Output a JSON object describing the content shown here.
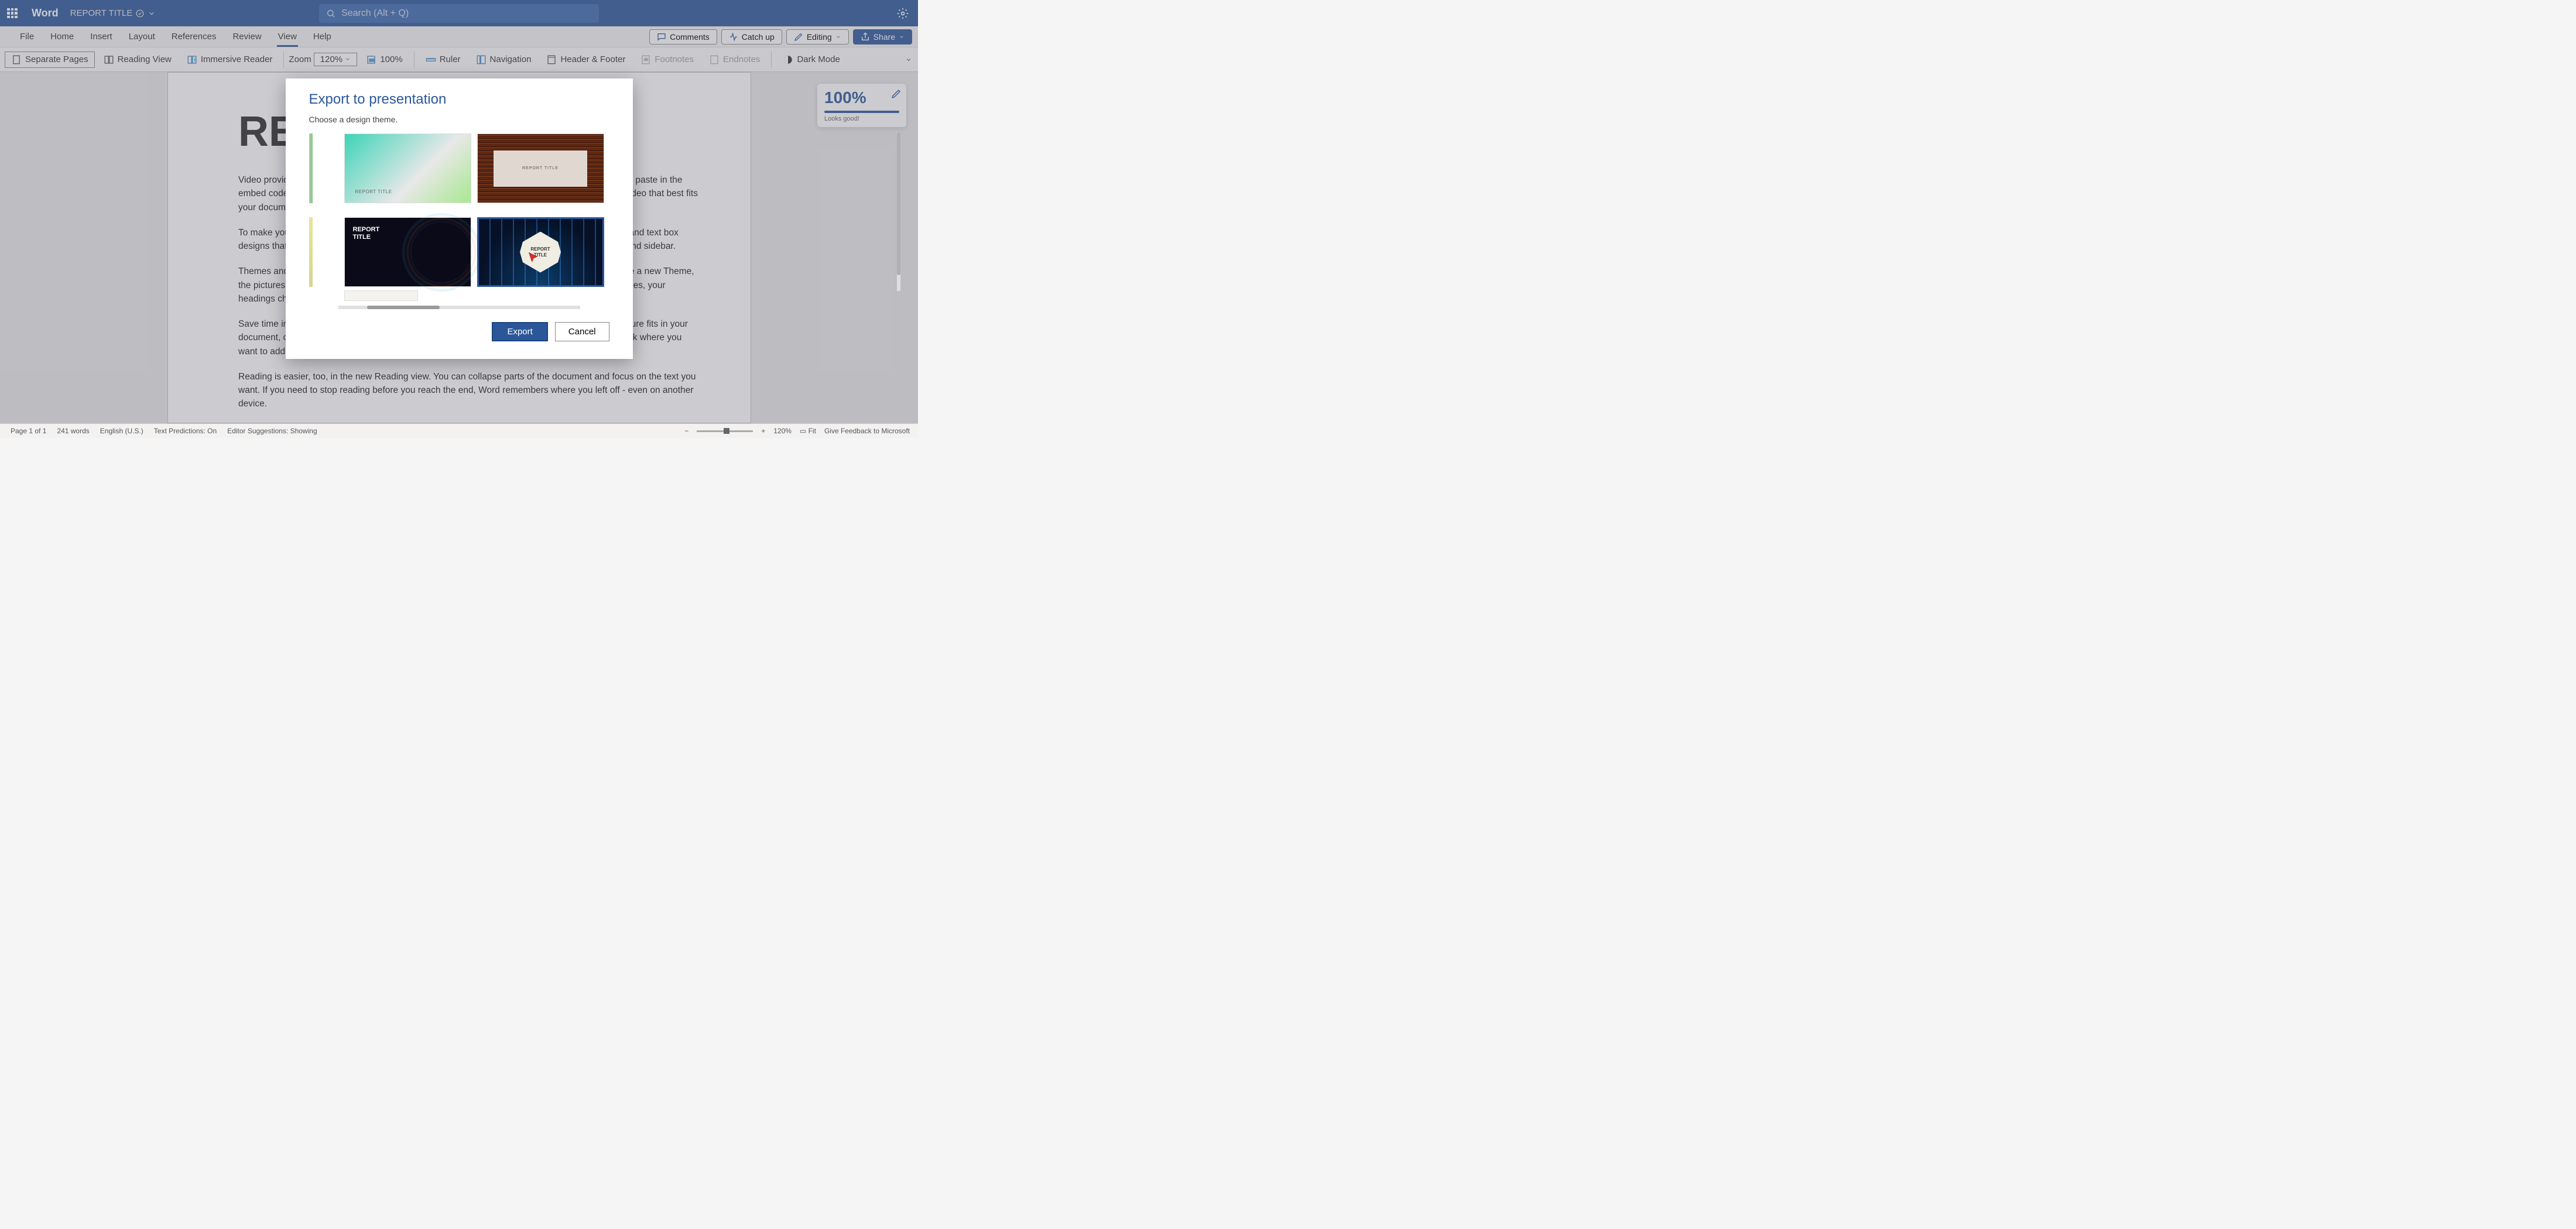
{
  "header": {
    "app_name": "Word",
    "doc_title": "REPORT TITLE",
    "search_placeholder": "Search (Alt + Q)"
  },
  "tabs": {
    "items": [
      "File",
      "Home",
      "Insert",
      "Layout",
      "References",
      "Review",
      "View",
      "Help"
    ],
    "active": "View",
    "right": {
      "comments": "Comments",
      "catchup": "Catch up",
      "editing": "Editing",
      "share": "Share"
    }
  },
  "ribbon": {
    "separate_pages": "Separate Pages",
    "reading_view": "Reading View",
    "immersive_reader": "Immersive Reader",
    "zoom_label": "Zoom",
    "zoom_dropdown": "120%",
    "zoom_100": "100%",
    "ruler": "Ruler",
    "navigation": "Navigation",
    "header_footer": "Header & Footer",
    "footnotes": "Footnotes",
    "endnotes": "Endnotes",
    "dark_mode": "Dark Mode"
  },
  "document": {
    "heading": "RE",
    "p1": "Video provides a powerful way to help you prove your point. When you click Online Video, you can paste in the embed code for the video you want to add. You can also type a keyword to search online for the video that best fits your document.",
    "p2": "To make your document look professionally produced, Word provides header, footer, cover page, and text box designs that complement each other. For example, you can add a matching cover page, header, and sidebar.",
    "p3": "Themes and styles also help keep your document coordinated. When you click Design and choose a new Theme, the pictures, charts, and SmartArt graphics change to match your new theme. When you apply styles, your headings change to match the new theme.",
    "p4": "Save time in Word with new buttons that show up where you need them. To change the way a picture fits in your document, click it and a button for layout options appears next to it. When you work on a table, click where you want to add a row or a column, and then click the plus sign.",
    "p5": "Reading is easier, too, in the new Reading view. You can collapse parts of the document and focus on the text you want. If you need to stop reading before you reach the end, Word remembers where you left off - even on another device."
  },
  "editor": {
    "pct": "100%",
    "msg": "Looks good!"
  },
  "modal": {
    "title": "Export to presentation",
    "subtitle": "Choose a design theme.",
    "theme_label": "REPORT TITLE",
    "theme_label_split": "REPORT\nTITLE",
    "export": "Export",
    "cancel": "Cancel"
  },
  "status": {
    "page": "Page 1 of 1",
    "words": "241 words",
    "lang": "English (U.S.)",
    "predictions": "Text Predictions: On",
    "suggestions": "Editor Suggestions: Showing",
    "zoom": "120%",
    "fit": "Fit",
    "feedback": "Give Feedback to Microsoft"
  }
}
